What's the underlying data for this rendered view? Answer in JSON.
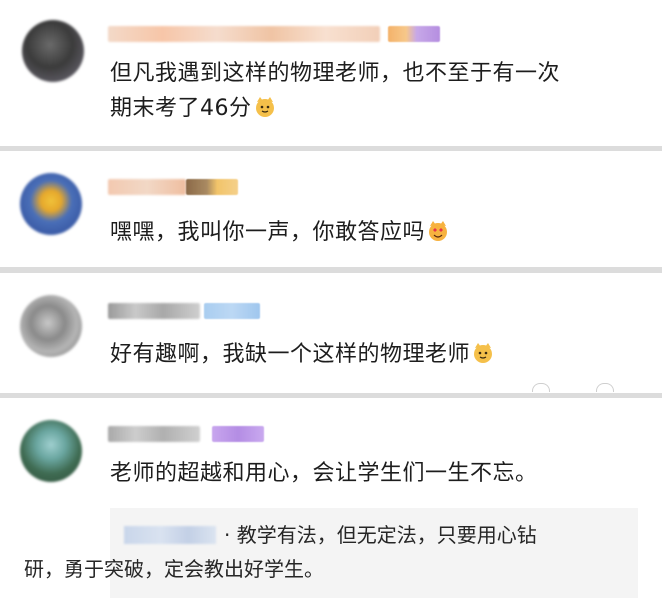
{
  "comments": [
    {
      "avatar_icon": "blurred-avatar-1",
      "text_line1": "但凡我遇到这样的物理老师，也不至于有一次",
      "text_line2": "期末考了46分",
      "emoji": "cat-face-emoji"
    },
    {
      "avatar_icon": "blurred-avatar-2",
      "text": "嘿嘿，我叫你一声，你敢答应吗",
      "emoji": "heart-eyes-cat-emoji"
    },
    {
      "avatar_icon": "blurred-avatar-3",
      "text": "好有趣啊，我缺一个这样的物理老师",
      "emoji": "cat-face-emoji"
    },
    {
      "avatar_icon": "blurred-avatar-4",
      "text": "老师的超越和用心，会让学生们一生不忘。",
      "reply": {
        "text_line1": "· 教学有法，但无定法，只要用心钻",
        "text_line2": "研，勇于突破，定会教出好学生。"
      }
    }
  ],
  "colors": {
    "background": "#dcdcdc",
    "card": "#ffffff",
    "reply_box": "#f4f4f4",
    "text": "#1d1d1d"
  }
}
